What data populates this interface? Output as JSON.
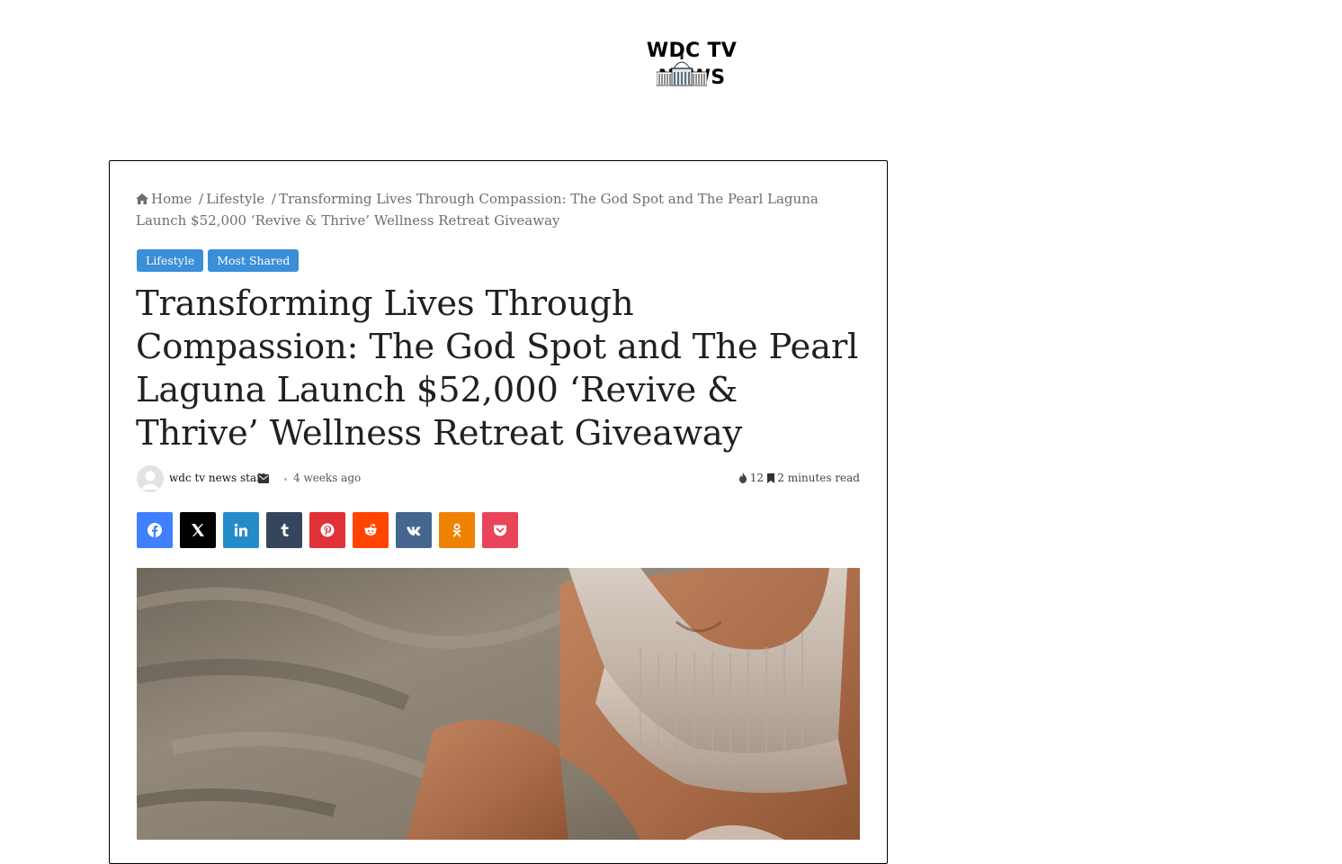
{
  "site": {
    "logo_text": "WDC TV NEWS"
  },
  "breadcrumb": {
    "home": "Home",
    "sep1": "/",
    "category": "Lifestyle",
    "sep2": "/",
    "current": "Transforming Lives Through Compassion: The God Spot and The Pearl Laguna Launch $52,000 ‘Revive & Thrive’ Wellness Retreat Giveaway"
  },
  "categories": [
    {
      "label": "Lifestyle",
      "color": "#3b8ed8"
    },
    {
      "label": "Most Shared",
      "color": "#3b8ed8"
    }
  ],
  "article": {
    "title": "Transforming Lives Through Compassion: The God Spot and The Pearl Laguna Launch $52,000 ‘Revive & Thrive’ Wellness Retreat Giveaway",
    "author": "wdc tv news staff",
    "date": "4 weeks ago",
    "views": "12",
    "read_time": "2 minutes read"
  },
  "share_buttons": [
    {
      "name": "facebook",
      "icon": "facebook-icon",
      "color": "#4080ff"
    },
    {
      "name": "x",
      "icon": "x-icon",
      "color": "#000000"
    },
    {
      "name": "linkedin",
      "icon": "linkedin-icon",
      "color": "#238cc8"
    },
    {
      "name": "tumblr",
      "icon": "tumblr-icon",
      "color": "#35465c"
    },
    {
      "name": "pinterest",
      "icon": "pinterest-icon",
      "color": "#e13138"
    },
    {
      "name": "reddit",
      "icon": "reddit-icon",
      "color": "#ff4500"
    },
    {
      "name": "vk",
      "icon": "vk-icon",
      "color": "#45668e"
    },
    {
      "name": "odnoklassniki",
      "icon": "odnoklassniki-icon",
      "color": "#ef8200"
    },
    {
      "name": "pocket",
      "icon": "pocket-icon",
      "color": "#e9445a"
    }
  ],
  "colors": {
    "accent": "#3b8ed8",
    "text": "#2c2f34"
  }
}
